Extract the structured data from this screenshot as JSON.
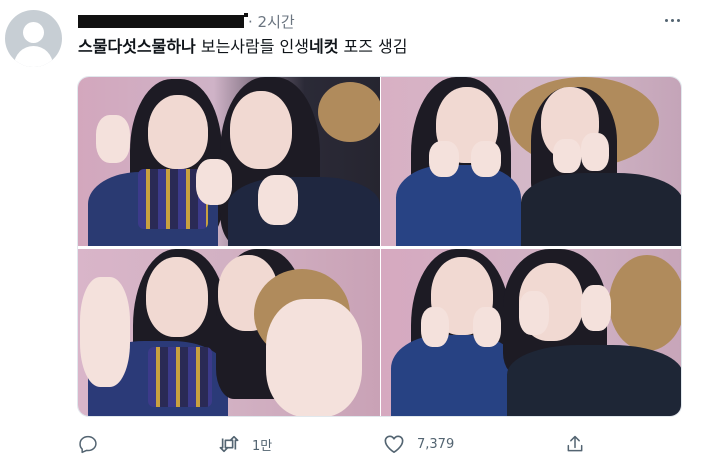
{
  "tweet": {
    "timestamp": "· 2시간",
    "text_plain_1": "스물다섯스물하나",
    "text_plain_2": " 보는사람들 인생",
    "text_bold": "네컷",
    "text_plain_3": " 포즈 생김"
  },
  "actions": {
    "reply_count": "",
    "retweet_count": "1만",
    "like_count": "7,379"
  },
  "icons": [
    "more-icon",
    "reply-icon",
    "retweet-icon",
    "like-icon",
    "share-icon"
  ],
  "colors": {
    "text": "#0f1419",
    "secondary": "#536471",
    "photo_background": "#d9b6c8"
  }
}
